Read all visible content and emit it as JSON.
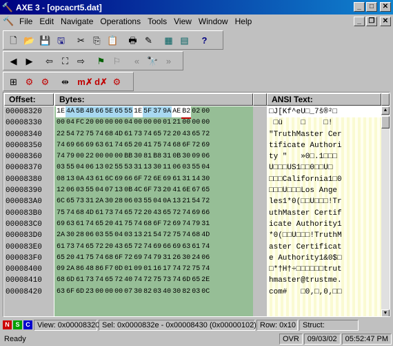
{
  "window": {
    "title": "AXE 3 - [opcacrt5.dat]",
    "buttons": {
      "minimize": "_",
      "maximize": "□",
      "close": "✕"
    },
    "mdi_buttons": {
      "minimize": "_",
      "restore": "❐",
      "close": "✕"
    }
  },
  "menu": [
    "File",
    "Edit",
    "Navigate",
    "Operations",
    "Tools",
    "View",
    "Window",
    "Help"
  ],
  "headers": {
    "offset": "Offset:",
    "bytes": "Bytes:",
    "ansi": "ANSI Text:"
  },
  "rows": [
    {
      "offset": "00008320",
      "bytes": [
        "1E",
        "4A",
        "5B",
        "4B",
        "66",
        "5E",
        "65",
        "55",
        "1E",
        "5F",
        "37",
        "9A",
        "AE",
        "B2",
        "02",
        "00"
      ],
      "ansi": "□J[Kf^eU□_7š®²□ "
    },
    {
      "offset": "00008330",
      "bytes": [
        "00",
        "04",
        "FC",
        "20",
        "00",
        "00",
        "00",
        "04",
        "00",
        "00",
        "00",
        "01",
        "21",
        "00",
        "00",
        "00"
      ],
      "ansi": " □ü    □    □!   "
    },
    {
      "offset": "00008340",
      "bytes": [
        "22",
        "54",
        "72",
        "75",
        "74",
        "68",
        "4D",
        "61",
        "73",
        "74",
        "65",
        "72",
        "20",
        "43",
        "65",
        "72"
      ],
      "ansi": "\"TruthMaster Cer"
    },
    {
      "offset": "00008350",
      "bytes": [
        "74",
        "69",
        "66",
        "69",
        "63",
        "61",
        "74",
        "65",
        "20",
        "41",
        "75",
        "74",
        "68",
        "6F",
        "72",
        "69"
      ],
      "ansi": "tificate Authori"
    },
    {
      "offset": "00008360",
      "bytes": [
        "74",
        "79",
        "00",
        "22",
        "00",
        "00",
        "00",
        "BB",
        "30",
        "81",
        "B8",
        "31",
        "0B",
        "30",
        "09",
        "06"
      ],
      "ansi": "ty \"   »0□.1□□□"
    },
    {
      "offset": "00008370",
      "bytes": [
        "03",
        "55",
        "04",
        "06",
        "13",
        "02",
        "55",
        "53",
        "31",
        "13",
        "30",
        "11",
        "06",
        "03",
        "55",
        "04"
      ],
      "ansi": "U□□□US1□□0□□U□"
    },
    {
      "offset": "00008380",
      "bytes": [
        "08",
        "13",
        "0A",
        "43",
        "61",
        "6C",
        "69",
        "66",
        "6F",
        "72",
        "6E",
        "69",
        "61",
        "31",
        "14",
        "30"
      ],
      "ansi": "□□□California1□0"
    },
    {
      "offset": "00008390",
      "bytes": [
        "12",
        "06",
        "03",
        "55",
        "04",
        "07",
        "13",
        "0B",
        "4C",
        "6F",
        "73",
        "20",
        "41",
        "6E",
        "67",
        "65"
      ],
      "ansi": "□□□U□□□Los Ange"
    },
    {
      "offset": "000083A0",
      "bytes": [
        "6C",
        "65",
        "73",
        "31",
        "2A",
        "30",
        "28",
        "06",
        "03",
        "55",
        "04",
        "0A",
        "13",
        "21",
        "54",
        "72"
      ],
      "ansi": "les1*0(□□U□□□!Tr"
    },
    {
      "offset": "000083B0",
      "bytes": [
        "75",
        "74",
        "68",
        "4D",
        "61",
        "73",
        "74",
        "65",
        "72",
        "20",
        "43",
        "65",
        "72",
        "74",
        "69",
        "66"
      ],
      "ansi": "uthMaster Certif"
    },
    {
      "offset": "000083C0",
      "bytes": [
        "69",
        "63",
        "61",
        "74",
        "65",
        "20",
        "41",
        "75",
        "74",
        "68",
        "6F",
        "72",
        "69",
        "74",
        "79",
        "31"
      ],
      "ansi": "icate Authority1"
    },
    {
      "offset": "000083D0",
      "bytes": [
        "2A",
        "30",
        "28",
        "06",
        "03",
        "55",
        "04",
        "03",
        "13",
        "21",
        "54",
        "72",
        "75",
        "74",
        "68",
        "4D"
      ],
      "ansi": "*0(□□U□□□!TruthM"
    },
    {
      "offset": "000083E0",
      "bytes": [
        "61",
        "73",
        "74",
        "65",
        "72",
        "20",
        "43",
        "65",
        "72",
        "74",
        "69",
        "66",
        "69",
        "63",
        "61",
        "74"
      ],
      "ansi": "aster Certificat"
    },
    {
      "offset": "000083F0",
      "bytes": [
        "65",
        "20",
        "41",
        "75",
        "74",
        "68",
        "6F",
        "72",
        "69",
        "74",
        "79",
        "31",
        "26",
        "30",
        "24",
        "06"
      ],
      "ansi": "e Authority1&0$□"
    },
    {
      "offset": "00008400",
      "bytes": [
        "09",
        "2A",
        "86",
        "48",
        "86",
        "F7",
        "0D",
        "01",
        "09",
        "01",
        "16",
        "17",
        "74",
        "72",
        "75",
        "74"
      ],
      "ansi": "□*†H†÷□□□□□□trut"
    },
    {
      "offset": "00008410",
      "bytes": [
        "68",
        "6D",
        "61",
        "73",
        "74",
        "65",
        "72",
        "40",
        "74",
        "72",
        "75",
        "73",
        "74",
        "6D",
        "65",
        "2E"
      ],
      "ansi": "hmaster@trustme."
    },
    {
      "offset": "00008420",
      "bytes": [
        "63",
        "6F",
        "6D",
        "23",
        "00",
        "00",
        "00",
        "07",
        "30",
        "82",
        "03",
        "40",
        "30",
        "82",
        "03",
        "0C"
      ],
      "ansi": "com#   □0‚□,0‚□□"
    }
  ],
  "info": {
    "modes": [
      {
        "label": "N",
        "color": "#cc0000"
      },
      {
        "label": "S",
        "color": "#00a000"
      },
      {
        "label": "C",
        "color": "#0000cc"
      }
    ],
    "view": "View: 0x00008320",
    "sel": "Sel: 0x0000832e - 0x00008430 (0x00000102)",
    "row": "Row: 0x10",
    "struct": "Struct:"
  },
  "status": {
    "ready": "Ready",
    "ovr": "OVR",
    "date": "09/03/02",
    "time": "05:52:47 PM"
  },
  "toolbar_icons": {
    "row1": [
      "new-file-icon",
      "open-folder-icon",
      "save-icon",
      "save-all-icon",
      "cut-icon",
      "copy-icon",
      "paste-icon",
      "print-icon",
      "edit-pencil-icon",
      "calculator-icon",
      "structure-icon",
      "help-icon"
    ],
    "row2": [
      "back-icon",
      "forward-icon",
      "jump-back-icon",
      "zoom-fit-icon",
      "jump-forward-icon",
      "bookmark-set-icon",
      "bookmark-goto-icon",
      "find-prev-icon",
      "find-icon",
      "find-next-icon"
    ],
    "row3": [
      "view-structure-icon",
      "compare-icon",
      "compare-next-icon",
      "split-icon",
      "mark-x-icon",
      "mark-d-icon",
      "mark-clear-icon"
    ]
  }
}
